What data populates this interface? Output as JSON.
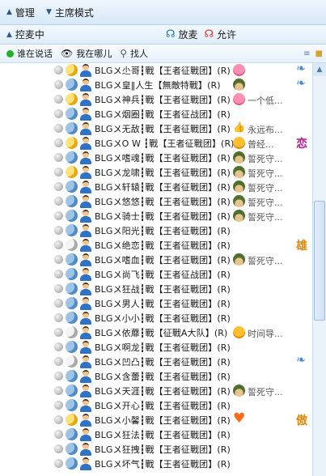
{
  "toolbar": {
    "manage_label": "管理",
    "host_mode_label": "主席模式"
  },
  "micbar": {
    "control_label": "控麦中",
    "release_label": "放麦",
    "allow_label": "允许"
  },
  "filterbar": {
    "who_speaking": "谁在说话",
    "where_am_i": "我在哪儿",
    "find_person": "找人"
  },
  "members": [
    {
      "moon": "y",
      "nick": "BLG〤尐哥┇戰【王者征戰团】(R)",
      "emo": "pink",
      "sig": "",
      "side": "badge"
    },
    {
      "moon": "b",
      "nick": "BLG〤皇‖人生【無敵特戰】(R)",
      "emo": "soldier",
      "sig": "",
      "side": "badge"
    },
    {
      "moon": "y",
      "nick": "BLG〤神兵┇戰【王者征戰团】(R)",
      "emo": "pink",
      "sig": "一个低...",
      "side": ""
    },
    {
      "moon": "b",
      "nick": "BLG〤烟圈┇戰【王者征战团】(R)",
      "emo": "",
      "sig": "",
      "side": ""
    },
    {
      "moon": "b",
      "nick": "BLG〤无敌┇戰【王者征戰团】(R)",
      "emo": "thumb",
      "sig": "永远布...",
      "side": ""
    },
    {
      "moon": "y",
      "nick": "BLG〤O W ┇戰【王者征戰团】(R)",
      "emo": "smile",
      "sig": "曾经...",
      "side": "恋"
    },
    {
      "moon": "b",
      "nick": "BLG〤嗜魂┇戰【王者征戰团】(R)",
      "emo": "soldier",
      "sig": "誓死守...",
      "side": ""
    },
    {
      "moon": "y",
      "nick": "BLG〤龙啸┇戰【王者征戰团】(R)",
      "emo": "soldier",
      "sig": "誓死守...",
      "side": ""
    },
    {
      "moon": "b",
      "nick": "BLG〤轩辕┇戰【王者征戰团】(R)",
      "emo": "soldier",
      "sig": "誓死守...",
      "side": ""
    },
    {
      "moon": "b",
      "nick": "BLG〤悠悠┇戰【王者征戰团】(R)",
      "emo": "soldier",
      "sig": "誓死守...",
      "side": ""
    },
    {
      "moon": "b",
      "nick": "BLG〤骑士┇戰【王者征戰团】(R)",
      "emo": "soldier",
      "sig": "誓死守...",
      "side": ""
    },
    {
      "moon": "b",
      "nick": "BLG〤阳光┇戰【王者征戰团】(R)",
      "emo": "",
      "sig": "",
      "side": ""
    },
    {
      "moon": "g",
      "nick": "BLG〤绝恋┇戰【王者征戰团】(R)",
      "emo": "",
      "sig": "",
      "side": "雄"
    },
    {
      "moon": "b",
      "nick": "BLG〤嗜血┇戰【王者征戰团】(R)",
      "emo": "soldier",
      "sig": "誓死守...",
      "side": ""
    },
    {
      "moon": "b",
      "nick": "BLG〤尚飞┇戰【王者征战团】(R)",
      "emo": "",
      "sig": "",
      "side": ""
    },
    {
      "moon": "b",
      "nick": "BLG〤狂战┇戰【王者征戰团】(R)",
      "emo": "",
      "sig": "",
      "side": ""
    },
    {
      "moon": "b",
      "nick": "BLG〤男人┇戰【王者征戰团】(R)",
      "emo": "",
      "sig": "",
      "side": ""
    },
    {
      "moon": "b",
      "nick": "BLG〤小小┇戰【王者征戰团】(R)",
      "emo": "",
      "sig": "",
      "side": ""
    },
    {
      "moon": "g",
      "nick": "BLG〤依蘼┇戰【征戰A大队】(R)",
      "emo": "smile",
      "sig": "时间导...",
      "side": ""
    },
    {
      "moon": "b",
      "nick": "BLG〤啊龙┇戰【王者征戰团】(R)",
      "emo": "",
      "sig": "",
      "side": ""
    },
    {
      "moon": "g",
      "nick": "BLG〤凹凸┇戰【王者征戰团】(R)",
      "emo": "",
      "sig": "",
      "side": "badge"
    },
    {
      "moon": "b",
      "nick": "BLG〤含蕾┇戰【王者征戰团】(R)",
      "emo": "",
      "sig": "",
      "side": ""
    },
    {
      "moon": "b",
      "nick": "BLG〤天涯┇戰【王者征戰团】(R)",
      "emo": "soldier",
      "sig": "誓死守...",
      "side": ""
    },
    {
      "moon": "b",
      "nick": "BLG〤开心┇戰【王者征戰团】(R)",
      "emo": "",
      "sig": "",
      "side": ""
    },
    {
      "moon": "y",
      "nick": "BLG〤小馨┇戰【王者征戰团】(R)",
      "emo": "heart",
      "sig": "",
      "side": "傲"
    },
    {
      "moon": "b",
      "nick": "BLG〤狂法┇戰【王者征戰团】(R)",
      "emo": "",
      "sig": "",
      "side": ""
    },
    {
      "moon": "b",
      "nick": "BLG〤狂拽┇戰【王者征戰团】(R)",
      "emo": "",
      "sig": "",
      "side": ""
    },
    {
      "moon": "b",
      "nick": "BLG〤坏气┇戰【王者征戰团】(R)",
      "emo": "",
      "sig": "",
      "side": ""
    }
  ]
}
